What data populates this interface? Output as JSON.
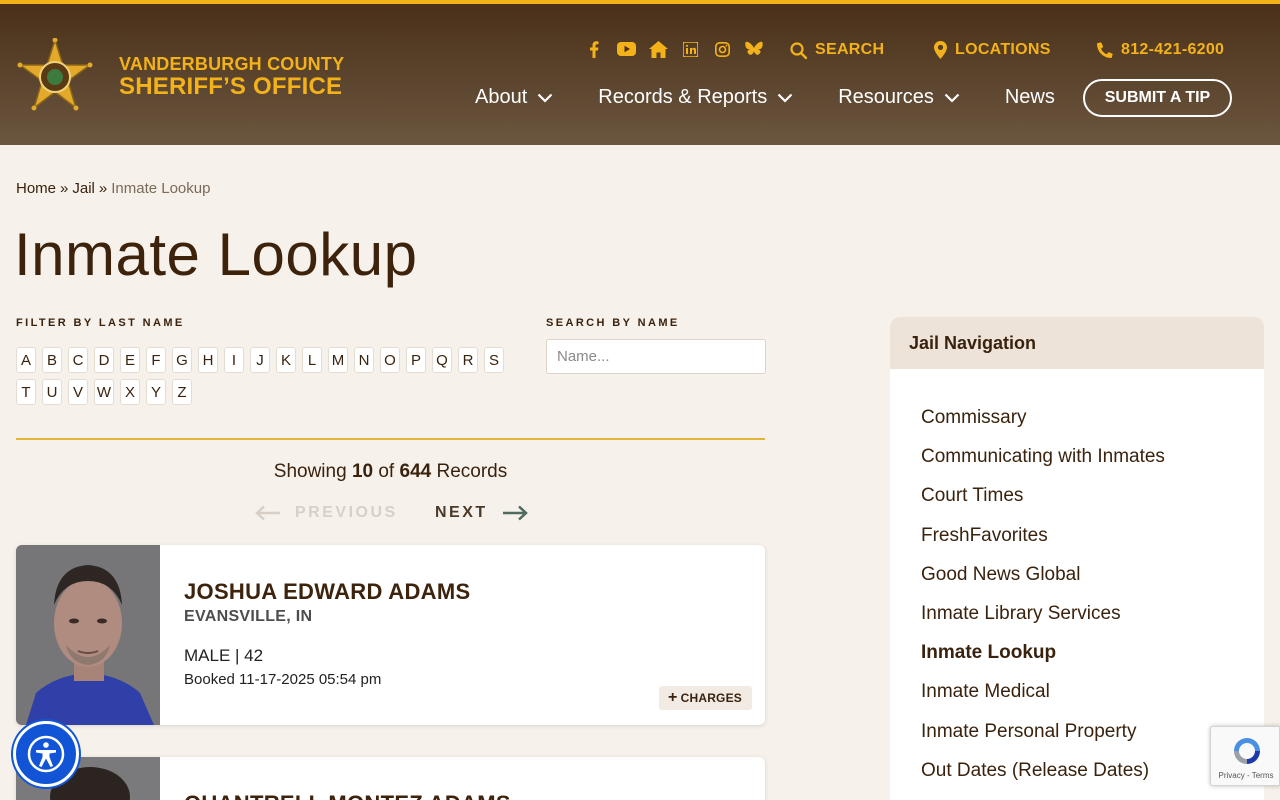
{
  "site": {
    "name_line1": "VANDERBURGH COUNTY",
    "name_line2": "SHERIFF’S OFFICE"
  },
  "header": {
    "social": [
      "facebook-icon",
      "youtube-icon",
      "home-icon",
      "linkedin-icon",
      "instagram-icon",
      "bluesky-icon"
    ],
    "search_label": "SEARCH",
    "locations_label": "LOCATIONS",
    "phone": "812-421-6200",
    "nav": [
      {
        "label": "About",
        "dropdown": true
      },
      {
        "label": "Records & Reports",
        "dropdown": true
      },
      {
        "label": "Resources",
        "dropdown": true
      },
      {
        "label": "News",
        "dropdown": false
      }
    ],
    "tip_button": "SUBMIT A TIP"
  },
  "breadcrumb": {
    "home": "Home",
    "jail": "Jail",
    "current": "Inmate Lookup",
    "separator": "»"
  },
  "page": {
    "title": "Inmate Lookup",
    "filter_label": "FILTER BY LAST NAME",
    "search_label": "SEARCH BY NAME",
    "search_placeholder": "Name...",
    "letters": [
      "A",
      "B",
      "C",
      "D",
      "E",
      "F",
      "G",
      "H",
      "I",
      "J",
      "K",
      "L",
      "M",
      "N",
      "O",
      "P",
      "Q",
      "R",
      "S",
      "T",
      "U",
      "V",
      "W",
      "X",
      "Y",
      "Z"
    ]
  },
  "results": {
    "showing_prefix": "Showing",
    "shown": "10",
    "of_word": "of",
    "total": "644",
    "records_word": "Records",
    "prev_label": "PREVIOUS",
    "next_label": "NEXT"
  },
  "inmates": [
    {
      "name": "JOSHUA EDWARD ADAMS",
      "city": "EVANSVILLE, IN",
      "sex_age": "MALE | 42",
      "booked": "Booked 11-17-2025 05:54 pm",
      "charges_label": "CHARGES"
    },
    {
      "name": "QUANTRELL MONTEZ ADAMS"
    }
  ],
  "sidebar": {
    "title": "Jail Navigation",
    "items": [
      {
        "label": "Commissary",
        "active": false
      },
      {
        "label": "Communicating with Inmates",
        "active": false
      },
      {
        "label": "Court Times",
        "active": false
      },
      {
        "label": "FreshFavorites",
        "active": false
      },
      {
        "label": "Good News Global",
        "active": false
      },
      {
        "label": "Inmate Library Services",
        "active": false
      },
      {
        "label": "Inmate Lookup",
        "active": true
      },
      {
        "label": "Inmate Medical",
        "active": false
      },
      {
        "label": "Inmate Personal Property",
        "active": false
      },
      {
        "label": "Out Dates (Release Dates)",
        "active": false
      }
    ]
  },
  "recaptcha": {
    "footer": "Privacy - Terms"
  },
  "colors": {
    "accent_gold": "#f3b21a",
    "header_brown": "#4a3019",
    "text_brown": "#3a230e",
    "a11y_blue": "#1155d6"
  }
}
